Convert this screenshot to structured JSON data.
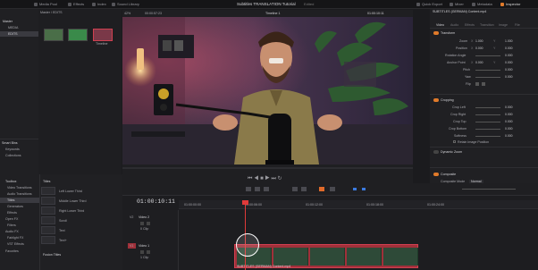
{
  "app": {
    "title": "Subtitles TRANSLATION Tutorial",
    "title_suffix": "Edited",
    "menu": [
      {
        "label": "Media Pool",
        "icon": "media-pool-icon"
      },
      {
        "label": "Effects",
        "icon": "effects-icon"
      },
      {
        "label": "Index",
        "icon": "index-icon"
      },
      {
        "label": "Sound Library",
        "icon": "sound-library-icon"
      }
    ],
    "right_menu": [
      {
        "label": "Quick Export",
        "icon": "export-icon"
      },
      {
        "label": "Mixer",
        "icon": "mixer-icon"
      },
      {
        "label": "Metadata",
        "icon": "metadata-icon"
      },
      {
        "label": "Inspector",
        "icon": "inspector-icon"
      }
    ]
  },
  "media_pool": {
    "breadcrumb": "Master / EDITS",
    "folders": [
      "Master",
      "MEDIA",
      "EDITS"
    ],
    "clips": [
      {
        "label": "",
        "color": "#4a6e48"
      },
      {
        "label": "",
        "color": "#3a8a4a"
      },
      {
        "label": "Timeline",
        "color": "#7a3848"
      }
    ],
    "smart_bins_header": "Smart Bins",
    "smart_bins": [
      "Keywords",
      "Collections"
    ]
  },
  "viewer": {
    "zoom": "42%",
    "source_timecode": "00:00:57:23",
    "timeline_name": "Timeline 1",
    "record_timecode": "01:00:10:11"
  },
  "effects": {
    "header": "Toolbox",
    "tree": [
      "Video Transitions",
      "Audio Transitions",
      "Titles",
      "Generators",
      "Effects",
      "Open FX",
      "Filters",
      "Audio FX",
      "Fairlight FX",
      "VST Effects",
      "Favorites"
    ],
    "list_header": "Titles",
    "list": [
      "Left Lower Third",
      "Middle Lower Third",
      "Right Lower Third",
      "Scroll",
      "Text",
      "Text+"
    ],
    "fusion_header": "Fusion Titles"
  },
  "inspector": {
    "clip_name": "SUBTITLES (GERMAN) Content.mp4",
    "tabs": [
      "Video",
      "Audio",
      "Effects",
      "Transition",
      "Image",
      "File"
    ],
    "transform": {
      "header": "Transform",
      "rows": [
        {
          "label": "Zoom",
          "x_label": "X",
          "x": "1.000",
          "y_label": "Y",
          "y": "1.000"
        },
        {
          "label": "Position",
          "x_label": "X",
          "x": "0.000",
          "y_label": "Y",
          "y": "0.000"
        },
        {
          "label": "Rotation Angle",
          "x_label": "",
          "x": "0.000",
          "y_label": "",
          "y": ""
        },
        {
          "label": "Anchor Point",
          "x_label": "X",
          "x": "0.000",
          "y_label": "Y",
          "y": "0.000"
        },
        {
          "label": "Pitch",
          "x_label": "",
          "x": "0.000",
          "y_label": "",
          "y": ""
        },
        {
          "label": "Yaw",
          "x_label": "",
          "x": "0.000",
          "y_label": "",
          "y": ""
        },
        {
          "label": "Flip",
          "x_label": "",
          "x": "",
          "y_label": "",
          "y": ""
        }
      ]
    },
    "cropping": {
      "header": "Cropping",
      "rows": [
        {
          "label": "Crop Left",
          "value": "0.000"
        },
        {
          "label": "Crop Right",
          "value": "0.000"
        },
        {
          "label": "Crop Top",
          "value": "0.000"
        },
        {
          "label": "Crop Bottom",
          "value": "0.000"
        },
        {
          "label": "Softness",
          "value": "0.000"
        }
      ],
      "retain": "Retain Image Position"
    },
    "dynamic_zoom": {
      "header": "Dynamic Zoom"
    },
    "composite": {
      "header": "Composite",
      "mode_label": "Composite Mode",
      "mode_value": "Normal",
      "opacity_label": "Opacity",
      "opacity_value": "100.00"
    }
  },
  "timeline": {
    "timecode": "01:00:10:11",
    "ruler_labels": [
      "01:00:00:00",
      "01:00:06:00",
      "01:00:12:00",
      "01:00:18:00",
      "01:00:24:00"
    ],
    "tracks": [
      {
        "id": "V2",
        "name": "Video 2",
        "clips_label": "0 Clip"
      },
      {
        "id": "V1",
        "name": "Video 1",
        "clips_label": "1 Clip"
      }
    ],
    "clip_name": "SUBTITLES (GERMAN) Content.mp4"
  }
}
